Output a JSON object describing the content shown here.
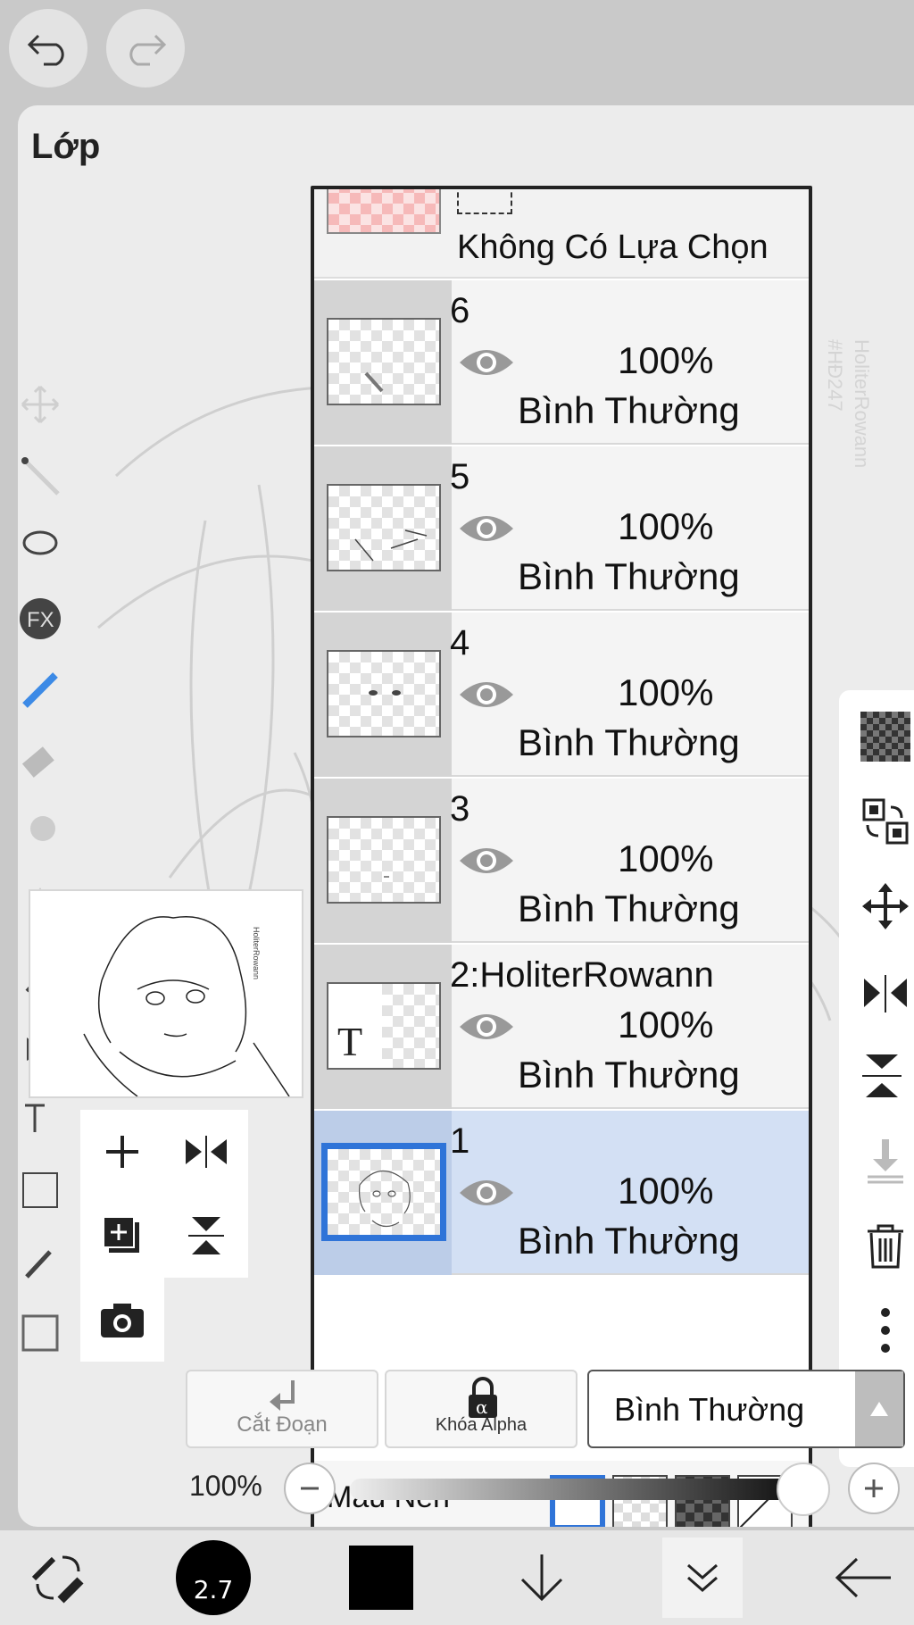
{
  "panel": {
    "title": "Lớp"
  },
  "selection": {
    "label": "Không Có Lựa Chọn"
  },
  "layers": [
    {
      "name": "6",
      "opacity": "100%",
      "blend": "Bình Thường"
    },
    {
      "name": "5",
      "opacity": "100%",
      "blend": "Bình Thường"
    },
    {
      "name": "4",
      "opacity": "100%",
      "blend": "Bình Thường"
    },
    {
      "name": "3",
      "opacity": "100%",
      "blend": "Bình Thường"
    },
    {
      "name": "2:HoliterRowann",
      "opacity": "100%",
      "blend": "Bình Thường"
    },
    {
      "name": "1",
      "opacity": "100%",
      "blend": "Bình Thường",
      "active": true
    }
  ],
  "background": {
    "label": "Màu Nền"
  },
  "buttons": {
    "cut": "Cắt Đoạn",
    "alpha_lock": "Khóa Alpha",
    "blend_mode": "Bình Thường"
  },
  "opacity_slider": {
    "label": "100%",
    "value": 1.0
  },
  "brush_size": "2.7",
  "colors": {
    "accent": "#2f74d8",
    "active_row": "#d3e0f4",
    "current_color": "#000000"
  }
}
